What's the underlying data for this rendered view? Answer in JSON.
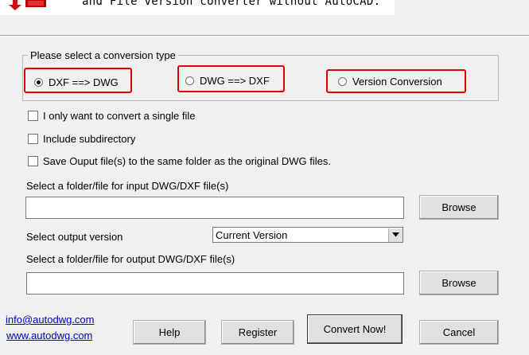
{
  "header": {
    "subtitle": "and File version converter without AutoCAD."
  },
  "conversion": {
    "title": "Please select a conversion type",
    "options": [
      {
        "label": "DXF ==> DWG",
        "selected": true
      },
      {
        "label": "DWG ==> DXF",
        "selected": false
      },
      {
        "label": "Version Conversion",
        "selected": false
      }
    ],
    "highlight_color": "#e00000"
  },
  "options": {
    "single_file": "I only want to convert a single file",
    "subdirectory": "Include subdirectory",
    "same_folder": "Save Ouput file(s) to the same folder as the original DWG files."
  },
  "input": {
    "label": "Select a folder/file for input DWG/DXF file(s)",
    "value": "",
    "browse": "Browse"
  },
  "output_version": {
    "label": "Select  output version",
    "selected": "Current Version"
  },
  "output": {
    "label": "Select a folder/file for output DWG/DXF file(s)",
    "value": "",
    "browse": "Browse"
  },
  "links": {
    "email": "info@autodwg.com",
    "website": "www.autodwg.com"
  },
  "buttons": {
    "help": "Help",
    "register": "Register",
    "convert": "Convert Now!",
    "cancel": "Cancel"
  }
}
